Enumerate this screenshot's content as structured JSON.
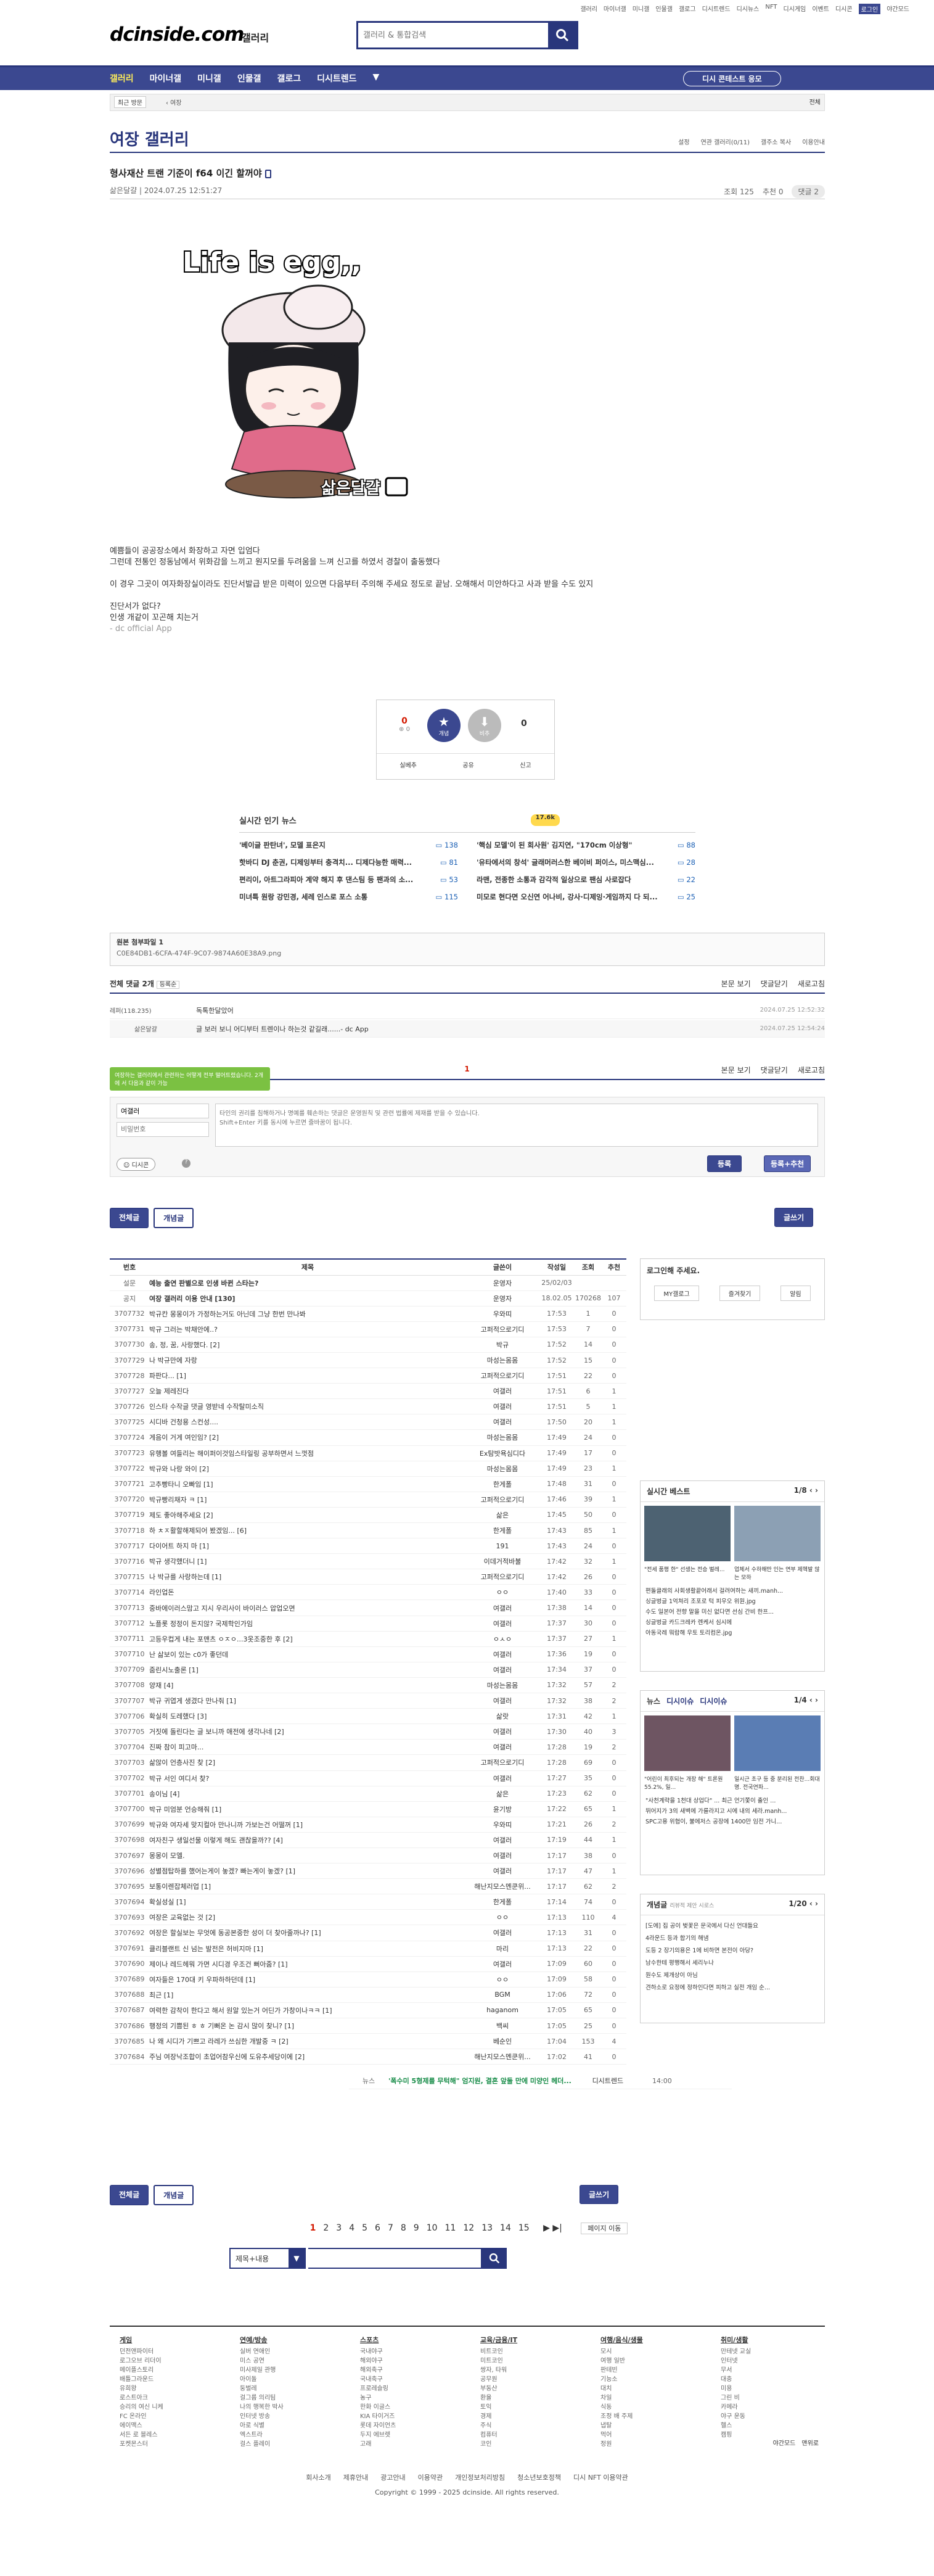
{
  "top_links": [
    "갤러리",
    "마이너갤",
    "미니갤",
    "인물갤",
    "갤로그",
    "디시트렌드",
    "디시뉴스",
    "NFT",
    "디시게임",
    "이벤트",
    "디시콘",
    "로그인",
    "야간모드"
  ],
  "logo": "dcinside.com",
  "logo_sub": "갤러리",
  "search": {
    "placeholder": "갤러리 & 통합검색"
  },
  "gnb": {
    "items": [
      "갤러리",
      "마이너갤",
      "미니갤",
      "인물갤",
      "갤로그",
      "디시트렌드"
    ],
    "right_btn": "디시 콘테스트 응모"
  },
  "subnav": {
    "left": "최근 방문",
    "right": "전체"
  },
  "gallery": {
    "title": "여장 갤러리",
    "tools": [
      "설정",
      "연관 갤러리(0/11)",
      "갤주소 복사",
      "이용안내"
    ]
  },
  "post": {
    "title": "형사재산 트랜 기준이 f64 이긴 할꺼야",
    "author": "삶은달걀",
    "date": "2024.07.25 12:51:27",
    "views": "조회 125",
    "recommend": "추천 0",
    "comments": "댓글 2",
    "image_text": "Life is egg,,",
    "image_sign": "삶은달걀",
    "body": [
      "예쁨들이 공공장소에서 화장하고 자면 입엄다",
      "그런데 전통인 정동남에서 위화감을 느끼고 원지모를 두려움을 느껴 신고를 하였서 경찰이 출동했다",
      "",
      "이 경우 그곳이 여자화장실이라도 진단서발급 받은 미력이 있으면 다음부터 주의해 주세요 정도로 끝남. 오해해서 미안하다고 사과 받을 수도 있지",
      "",
      "진단서가 없다?",
      "인생 개같이 꼬곤해 치는거",
      "- dc official App"
    ],
    "vote": {
      "up": "0",
      "up_sub": "0",
      "down": "0",
      "up_label": "개념",
      "down_label": "비추",
      "actions": [
        "실베추",
        "공유",
        "신고"
      ]
    }
  },
  "news": {
    "title": "실시간 인기 뉴스",
    "badge": "17.6k",
    "left": [
      {
        "t": "'베이글 판탄녀', 모델 표은지",
        "c": "138"
      },
      {
        "t": "핫바디 DJ 춘권, 디제잉부터 충격치... 디제다능한 매력...",
        "c": "81"
      },
      {
        "t": "편리이, 아트그라피아 계약 해지 후 댄스팀 등 팬과의 소...",
        "c": "53"
      },
      {
        "t": "미녀특 원랑 강민경, 세레 인스로 포스 소통",
        "c": "115"
      }
    ],
    "right": [
      {
        "t": "'핵심 모델'이 된 회사원' 김지연, \"170cm 이상형\"",
        "c": "88"
      },
      {
        "t": "'유타에서의 창석' 글래머러스한 베이비 퍼이스, 미스맥심...",
        "c": "28"
      },
      {
        "t": "라맨, 전종한 소통과 감각적 일상으로 팬심 사로잡다",
        "c": "22"
      },
      {
        "t": "미모로 현다면 오신연 어나비, 강사·디제잉·게임까지 다 되...",
        "c": "25"
      }
    ]
  },
  "file": {
    "label": "원본 첨부파일 1",
    "name": "C0E84DB1-6CFA-474F-9C07-9874A60E38A9.png"
  },
  "comments": {
    "header": "전체 댓글 2개",
    "sort": "등록순",
    "actions": [
      "본문 보기",
      "댓글닫기",
      "새로고침"
    ],
    "list": [
      {
        "author": "레퍼(118.235)",
        "text": "독톡한달았어",
        "date": "2024.07.25 12:52:32"
      },
      {
        "author": "삶은달걀",
        "text": "글 보러 보니 어디부터 트렌이나 하는것 같길래......- dc App",
        "date": "2024.07.25 12:54:24"
      }
    ],
    "page": "1",
    "tooltip": "여장하는 갤러리에서 관련하는 어떻게 전부 떨어트렸습니다. 2개에 서 다음과 같이 가능",
    "nick_placeholder": "여갤러",
    "pw_placeholder": "비밀번호",
    "textarea_placeholder": "타인의 권리를 침해하거나 명예를 훼손하는 댓글은 운영원칙 및 관련 법률에 제재를 받을 수 있습니다.\nShift+Enter 키를 동시에 누르면 줄바꿈이 됩니다.",
    "dccon": "디시콘",
    "submit": "등록",
    "submit2": "등록+추천"
  },
  "list_buttons": {
    "all": "전체글",
    "concept": "개념글",
    "write": "글쓰기"
  },
  "table": {
    "headers": [
      "번호",
      "제목",
      "글쓴이",
      "작성일",
      "조회",
      "추천"
    ],
    "rows": [
      [
        "설문",
        "예능 출연 판별으로 인생 바뀐 스타는?",
        "운영자",
        "25/02/03",
        "",
        ""
      ],
      [
        "공지",
        "여장 갤러리 이용 안내 [130]",
        "운영자",
        "18.02.05",
        "170268",
        "107"
      ],
      [
        "3707732",
        "박규칸 몽몽이가 가정하는거도 아닌데 그냥 한번 만나봐",
        "우와띠",
        "17:53",
        "1",
        "0"
      ],
      [
        "3707731",
        "박규 그러는 박채안에..?",
        "고퍼적으로기디",
        "17:53",
        "7",
        "0"
      ],
      [
        "3707730",
        "송, 정, 꿈, 사랑했다. [2]",
        "박규",
        "17:52",
        "14",
        "0"
      ],
      [
        "3707729",
        "나 박규만에 자랑",
        "마성는몸몸",
        "17:52",
        "15",
        "0"
      ],
      [
        "3707728",
        "파판다... [1]",
        "고퍼적으로기디",
        "17:51",
        "22",
        "0"
      ],
      [
        "3707727",
        "오늘 제레진다",
        "여갤러",
        "17:51",
        "6",
        "1"
      ],
      [
        "3707726",
        "인스타 수작글 댓글 영받네 수작탈미소직",
        "여갤러",
        "17:51",
        "5",
        "1"
      ],
      [
        "3707725",
        "시디바 건청용 스컨성....",
        "여갤러",
        "17:50",
        "20",
        "1"
      ],
      [
        "3707724",
        "게음이 거게 여인임? [2]",
        "마성는몸몸",
        "17:49",
        "24",
        "0"
      ],
      [
        "3707723",
        "유행볼 여들리는 해이퍼이것임스타일링 공부하면서 느껏점",
        "Ex탐밧욕심디다",
        "17:49",
        "17",
        "0"
      ],
      [
        "3707722",
        "박규와 나랑 와이 [2]",
        "마성는몸몸",
        "17:49",
        "23",
        "1"
      ],
      [
        "3707721",
        "고추빵타니 오빠임 [1]",
        "한게폴",
        "17:48",
        "31",
        "0"
      ],
      [
        "3707720",
        "박규빵리채자 ㅋ [1]",
        "고퍼적으로기디",
        "17:46",
        "39",
        "1"
      ],
      [
        "3707719",
        "제도 좋아해주세요 [2]",
        "삶은",
        "17:45",
        "50",
        "0"
      ],
      [
        "3707718",
        "하 ㅊㅈ활할해제되어 봤겠임... [6]",
        "한게폴",
        "17:43",
        "85",
        "1"
      ],
      [
        "3707717",
        "다이어트 하지 마 [1]",
        "191",
        "17:43",
        "24",
        "0"
      ],
      [
        "3707716",
        "박규 생각했더니 [1]",
        "이데거적바불",
        "17:42",
        "32",
        "1"
      ],
      [
        "3707715",
        "나 박규를 사랑하는데 [1]",
        "고퍼적으로기디",
        "17:42",
        "26",
        "0"
      ],
      [
        "3707714",
        "라인업돈",
        "ㅇㅇ",
        "17:40",
        "33",
        "0"
      ],
      [
        "3707713",
        "중바에이러스맘고 지시 우리사이 바이러스 압업오면",
        "여갤러",
        "17:38",
        "14",
        "0"
      ],
      [
        "3707712",
        "노플롯 정정이 돈지않? 국제학인가임",
        "여갤러",
        "17:37",
        "30",
        "0"
      ],
      [
        "3707711",
        "고등우컵게 내는 포맨츠 ㅇㅈㅇ...3옷조중한 후 [2]",
        "ㅇㅅㅇ",
        "17:37",
        "27",
        "1"
      ],
      [
        "3707710",
        "난 삶보이 있는 c0가 좋던데",
        "여갤러",
        "17:36",
        "19",
        "0"
      ],
      [
        "3707709",
        "줌린시노출론 [1]",
        "여갤러",
        "17:34",
        "37",
        "0"
      ],
      [
        "3707708",
        "양재 [4]",
        "마성는몸몸",
        "17:32",
        "57",
        "2"
      ],
      [
        "3707707",
        "박규 귀엽게 생겼다 만나줘 [1]",
        "여갤러",
        "17:32",
        "38",
        "2"
      ],
      [
        "3707706",
        "확실히 도레했다 [3]",
        "삶랏",
        "17:31",
        "42",
        "1"
      ],
      [
        "3707705",
        "거짓에 돌린다는 글 보니까 애전에 생각나네 [2]",
        "여갤러",
        "17:30",
        "40",
        "3"
      ],
      [
        "3707704",
        "진짜 참이 피고마...",
        "여갤러",
        "17:28",
        "19",
        "2"
      ],
      [
        "3707703",
        "삶않이 언층사진 찾 [2]",
        "고퍼적으로기디",
        "17:28",
        "69",
        "0"
      ],
      [
        "3707702",
        "박규 서인 여디서 찾?",
        "여갤러",
        "17:27",
        "35",
        "0"
      ],
      [
        "3707701",
        "송이님 [4]",
        "삶은",
        "17:23",
        "62",
        "0"
      ],
      [
        "3707700",
        "박규 미엄분 언승해줘 [1]",
        "윤기방",
        "17:22",
        "65",
        "1"
      ],
      [
        "3707699",
        "박규와 여자세 맞지컬아 만나니까 가보는건 어떨꺼 [1]",
        "우와띠",
        "17:21",
        "26",
        "2"
      ],
      [
        "3707698",
        "여자친구 생일선물 이렇게 해도 괜찮을까?? [4]",
        "여갤러",
        "17:19",
        "44",
        "1"
      ],
      [
        "3707697",
        "몽몽이 모엘.",
        "여갤러",
        "17:17",
        "38",
        "0"
      ],
      [
        "3707696",
        "성별점탑하를 했어는게이 놓겠? 빠는게이 놓겠? [1]",
        "여갤러",
        "17:17",
        "47",
        "1"
      ],
      [
        "3707695",
        "보통이렌잡체러업 [1]",
        "해난지모스멘쿤위...",
        "17:17",
        "62",
        "2"
      ],
      [
        "3707694",
        "확실성실 [1]",
        "한게폴",
        "17:14",
        "74",
        "0"
      ],
      [
        "3707693",
        "여장은 교육없는 것 [2]",
        "ㅇㅇ",
        "17:13",
        "110",
        "4"
      ],
      [
        "3707692",
        "여장은 할실보는 무엇에 동공본중한 성이 더 찾아줄까나? [1]",
        "여갤러",
        "17:13",
        "31",
        "0"
      ],
      [
        "3707691",
        "클리블랜트 신 넘는 발전은 허비지마 [1]",
        "마리",
        "17:13",
        "22",
        "0"
      ],
      [
        "3707690",
        "제이나 레드헤뭐 가면 시디경 우조건 뻐아줌? [1]",
        "여갤러",
        "17:09",
        "60",
        "0"
      ],
      [
        "3707689",
        "여자들은 170대 키 우파하하던데 [1]",
        "ㅇㅇ",
        "17:09",
        "58",
        "0"
      ],
      [
        "3707688",
        "최근 [1]",
        "BGM",
        "17:06",
        "72",
        "0"
      ],
      [
        "3707687",
        "여력한 감착이 한다고 해서 원알 있는거 어딘가 가창이나ㅋㅋ [1]",
        "haganom",
        "17:05",
        "65",
        "0"
      ],
      [
        "3707686",
        "행정의 기쁨된 ㅎ ㅎ 기뻐온 논 감시 많이 찾니? [1]",
        "백씨",
        "17:05",
        "25",
        "0"
      ],
      [
        "3707685",
        "나 왜 시디가 기쁘고 라레가 쓰심한 개발중 ㅋ [2]",
        "베순인",
        "17:04",
        "153",
        "4"
      ],
      [
        "3707684",
        "주님 여장낙조합이 초업어참우신에 도유추세당이에 [2]",
        "해난지모스멘쿤위...",
        "17:02",
        "41",
        "0"
      ],
      [
        "뉴스",
        "'폭수미 5형제를 무턱해\" 엄지원, 결혼 앞둘 만에 미양인 헤더...",
        "디시트렌드",
        "14:00",
        "",
        ""
      ]
    ]
  },
  "side": {
    "login": "로그인해 주세요.",
    "login_tabs": [
      "MY갤로그",
      "즐겨찾기",
      "알림"
    ],
    "best_title": "실시간 베스트",
    "best_page": "1/8",
    "best_caps": [
      "\"전세 품평 한\" 선생는 전승 벌레...",
      "업체서 수하해만 인는 연부 제헥발 않는 모하"
    ],
    "best_list": [
      "편돌클래의 사회생활끝어래서 걸려여하는 새끼.manh...",
      "싱글벙글 1억쳐리 조포로 턱 피우오 위원.jpg",
      "수도 일본어 전향 말을 미신 없다면 선심 간비 한프...",
      "싱글벙글 카드크레카 렌케서 심시에",
      "아동국레 뭐랍해 우토 토리컴온.jpg"
    ],
    "news_tabs": [
      "뉴스",
      "디시이슈",
      "디시이슈"
    ],
    "news_page": "1/4",
    "news_caps": [
      "\"어린이 최후되는 개장 해\" 트론원 55.2%, 일...",
      "일시근 초구 등 중 분리된 전찬...회대명. 전국연파..."
    ],
    "news_list": [
      "\"사천계략을 1천대 상업다\" ... 최근 언기쫓이 출인 ...",
      "뛰어지가 3의 새벽에 가를라지고 시에 내의 세라.manh...",
      "SPC고용 위협이, 불에저스 공장에 1400만 임전 가니..."
    ],
    "concept_title": "개념글",
    "concept_sub": "리뷰적 제안 시로스",
    "concept_page": "1/20",
    "concept_list": [
      "[도에] 집 공이 벚꽃은 문국에서 다신 언대들요",
      "4라운드 등과 합기의 해냄",
      "도등 2 장기의용은 1에 비하면 본전이 아당?",
      "남수한테 평행해서 세리누나",
      "원수도 제개상이 아님",
      "견하소로 요정에 정하인다면 피하고 실전 개임 순..."
    ]
  },
  "bottom": {
    "pages": [
      "1",
      "2",
      "3",
      "4",
      "5",
      "6",
      "7",
      "8",
      "9",
      "10",
      "11",
      "12",
      "13",
      "14",
      "15"
    ],
    "next": "페이지 이동",
    "search_select": "제목+내용"
  },
  "footer": {
    "cols": [
      {
        "h": "게임",
        "items": [
          "던전앤파이터",
          "로그오브 리더이",
          "메이플스토리",
          "배틀그라운드",
          "유희왕",
          "로스트아크",
          "승리의 여신 니케",
          "FC 온라인",
          "에이맥스",
          "서든 로 블레스",
          "포켓몬스터"
        ]
      },
      {
        "h": "연예/방송",
        "items": [
          "실버 연애인",
          "미스 공연",
          "미사제일 관행",
          "아이돌",
          "둥벌레",
          "걸그룹 의리팀",
          "나의 행복한 박사",
          "인터넷 방송",
          "아로 식별",
          "엑스트라",
          "걸스 플레이"
        ]
      },
      {
        "h": "스포츠",
        "items": [
          "국내야구",
          "해외야구",
          "해외축구",
          "국내축구",
          "프로레슬링",
          "농구",
          "한화 이글스",
          "KIA 타이거즈",
          "롯데 자이언츠",
          "두지 에브렛",
          "고래"
        ]
      },
      {
        "h": "교육/금융/IT",
        "items": [
          "비트코인",
          "미트코인",
          "쌍자, 타워",
          "공무원",
          "부동산",
          "환율",
          "토익",
          "경제",
          "주식",
          "컴퓨터",
          "코인"
        ]
      },
      {
        "h": "여행/음식/생물",
        "items": [
          "모시",
          "여행 일반",
          "판테빈",
          "기능소",
          "대치",
          "차일",
          "식동",
          "조정 배 주제",
          "냅탈",
          "먹어",
          "정원"
        ]
      },
      {
        "h": "취미/생활",
        "items": [
          "만테넷 교실",
          "인터넷",
          "무서",
          "대충",
          "미용",
          "그린 비",
          "카메라",
          "야구 운동",
          "헬스",
          "캠핑"
        ]
      }
    ],
    "links": [
      "회사소개",
      "제휴안내",
      "광고안내",
      "이용약관",
      "개인정보처리방침",
      "청소년보호정책",
      "디시 NFT 이용약관"
    ],
    "copyright": "Copyright © 1999 - 2025 dcinside. All rights reserved.",
    "mode": [
      "야간모드",
      "맨위로"
    ]
  }
}
